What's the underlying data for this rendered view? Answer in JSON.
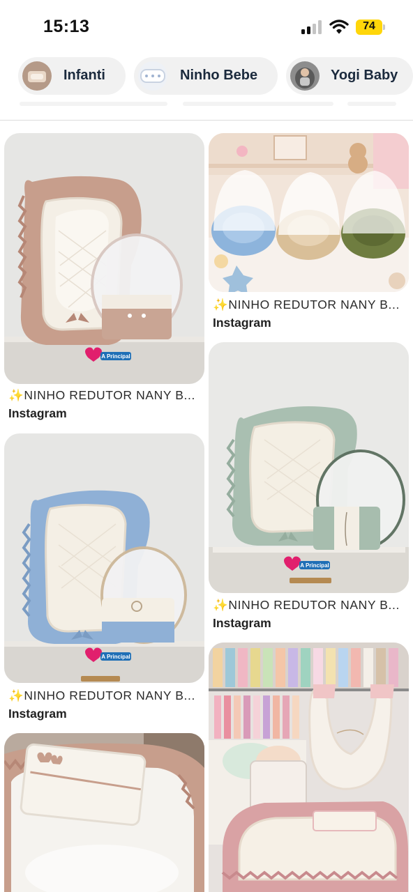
{
  "status_bar": {
    "time": "15:13",
    "battery_level": "74",
    "icons": [
      "cellular-signal-icon",
      "wifi-icon",
      "battery-icon"
    ],
    "battery_color": "#ffd60a"
  },
  "chips": [
    {
      "label": "Infanti",
      "icon": "infanti-thumbnail"
    },
    {
      "label": "Ninho Bebe",
      "icon": "ninho-bebe-thumbnail"
    },
    {
      "label": "Yogi Baby",
      "icon": "yogi-baby-thumbnail"
    }
  ],
  "pins": [
    {
      "title": "✨NINHO REDUTOR NANY B...",
      "source": "Instagram",
      "theme": "pink-nest",
      "watermark": "A Principal"
    },
    {
      "title": "✨NINHO REDUTOR NANY B...",
      "source": "Instagram",
      "theme": "three-nests-showroom"
    },
    {
      "title": "✨NINHO REDUTOR NANY B...",
      "source": "Instagram",
      "theme": "sage-nest",
      "watermark": "A Principal"
    },
    {
      "title": "✨NINHO REDUTOR NANY B...",
      "source": "Instagram",
      "theme": "blue-nest",
      "watermark": "A Principal"
    },
    {
      "title": "",
      "source": "",
      "theme": "rose-nest-store"
    },
    {
      "title": "",
      "source": "",
      "theme": "pink-nest-closeup"
    }
  ]
}
